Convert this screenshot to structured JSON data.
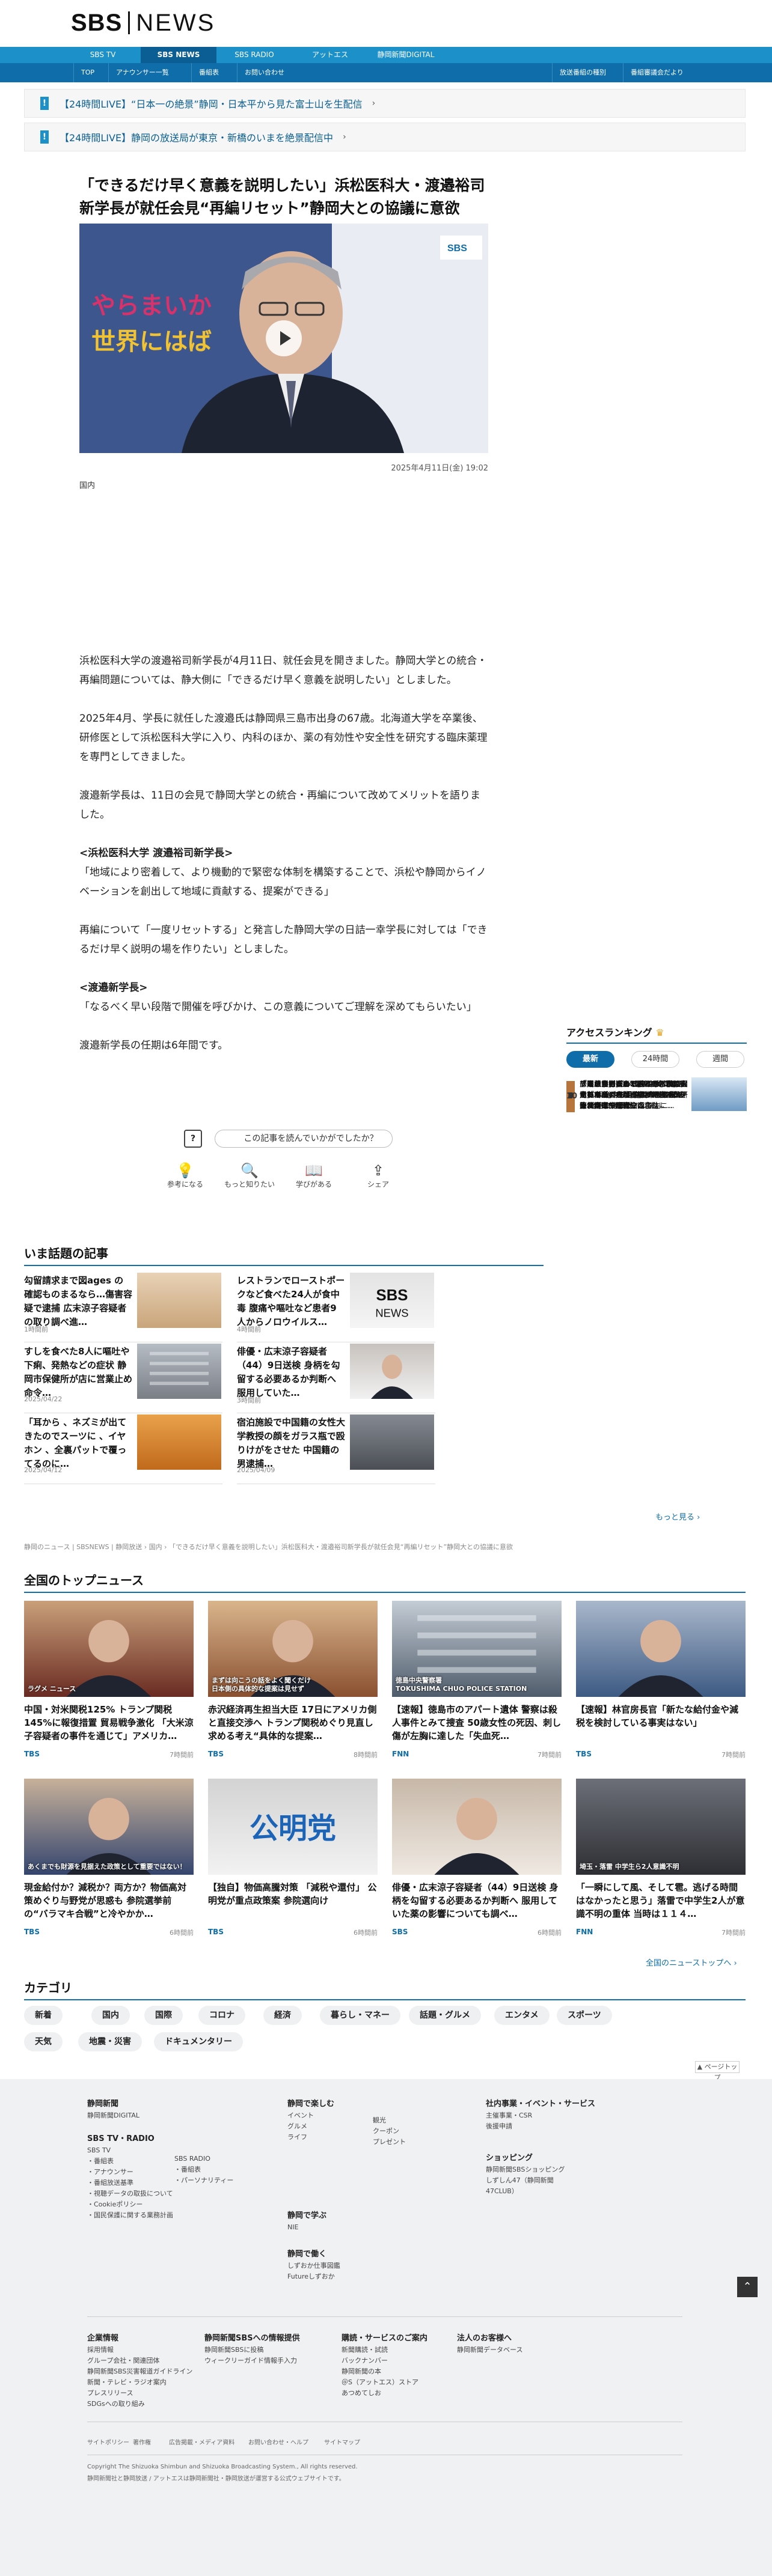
{
  "header": {
    "logo_sbs": "SBS",
    "logo_news": "NEWS"
  },
  "nav1": [
    {
      "label": "SBS TV",
      "active": false
    },
    {
      "label": "SBS NEWS",
      "active": true
    },
    {
      "label": "SBS RADIO",
      "active": false
    },
    {
      "label": "アットエス",
      "active": false
    },
    {
      "label": "静岡新聞DIGITAL",
      "active": false
    }
  ],
  "nav2": {
    "left": [
      "TOP",
      "アナウンサー一覧",
      "番組表",
      "お問い合わせ"
    ],
    "right": [
      "放送番組の種別",
      "番組審議会だより"
    ]
  },
  "alerts": [
    "【24時間LIVE】“日本一の絶景”静岡・日本平から見た富士山を生配信",
    "【24時間LIVE】静岡の放送局が東京・新橋のいまを絶景配信中"
  ],
  "article": {
    "title": "「できるだけ早く意義を説明したい」浜松医科大・渡邉裕司新学長が就任会見“再編リセット”静岡大との協議に意欲",
    "date": "2025年4月11日(金) 19:02",
    "category": "国内",
    "backdrop_text": "やらまいか\n世界にはば",
    "paragraphs": [
      {
        "h": false,
        "text": "浜松医科大学の渡邉裕司新学長が4月11日、就任会見を開きました。静岡大学との統合・再編問題については、静大側に「できるだけ早く意義を説明したい」としました。"
      },
      {
        "h": false,
        "text": "2025年4月、学長に就任した渡邉氏は静岡県三島市出身の67歳。北海道大学を卒業後、研修医として浜松医科大学に入り、内科のほか、薬の有効性や安全性を研究する臨床薬理を専門としてきました。"
      },
      {
        "h": false,
        "text": "渡邉新学長は、11日の会見で静岡大学との統合・再編について改めてメリットを語りました。"
      },
      {
        "h": true,
        "text": "<浜松医科大学 渡邉裕司新学長>"
      },
      {
        "h": false,
        "text": "「地域により密着して、より機動的で緊密な体制を構築することで、浜松や静岡からイノベーションを創出して地域に貢献する、提案ができる」"
      },
      {
        "h": false,
        "text": "再編について「一度リセットする」と発言した静岡大学の日詰一幸学長に対しては「できるだけ早く説明の場を作りたい」としました。"
      },
      {
        "h": true,
        "text": "<渡邉新学長>"
      },
      {
        "h": false,
        "text": "「なるべく早い段階で開催を呼びかけ、この意義についてご理解を深めてもらいたい」"
      },
      {
        "h": false,
        "text": "渡邉新学長の任期は6年間です。"
      }
    ]
  },
  "feedback": {
    "question": "この記事を読んでいかがでしたか？",
    "buttons": [
      {
        "label": "参考になる",
        "icon": "lightbulb-icon",
        "glyph": "💡"
      },
      {
        "label": "もっと知りたい",
        "icon": "search-icon",
        "glyph": "🔍"
      },
      {
        "label": "学びがある",
        "icon": "book-icon",
        "glyph": "📖"
      },
      {
        "label": "シェア",
        "icon": "share-icon",
        "glyph": "⇪"
      }
    ]
  },
  "topics": {
    "heading": "いま話題の記事",
    "items": [
      {
        "title": "勾留請求まで図ages の確認ものまるなら…傷害容疑で逮捕 広末涼子容疑者の取り調べ進…",
        "time": "1時間前",
        "img": "warm"
      },
      {
        "title": "レストランでローストポークなど食べた24人が食中毒 腹痛や嘔吐など患者9人からノロウイルス…",
        "time": "4時間前",
        "img": "sbslogo"
      },
      {
        "title": "すしを食べた8人に嘔吐や下痢、発熱などの症状 静岡市保健所が店に営業止め命令…",
        "time": "2025/04/22",
        "img": "building"
      },
      {
        "title": "俳優・広末涼子容疑者（44）9日送検 身柄を勾留する必要あるか判断へ 服用していた…",
        "time": "3時間前",
        "img": "woman"
      },
      {
        "title": "「耳から 、ネズミが出てきたのでスーツに 、イヤホン 、全裏パットで覆ってるのに…",
        "time": "2025/04/12",
        "img": "orange"
      },
      {
        "title": "宿泊施設で中国籍の女性大学教授の顔をガラス瓶で殴りけがをさせた 中国籍の男逮捕…",
        "time": "2025/04/09",
        "img": "gray"
      }
    ]
  },
  "ranking": {
    "heading": "アクセスランキング",
    "tabs": [
      {
        "label": "最新",
        "active": true
      },
      {
        "label": "24時間",
        "active": false
      },
      {
        "label": "週間",
        "active": false
      }
    ],
    "items": [
      {
        "n": "1",
        "color": "#e8a21b",
        "title": "すしを食べた8人に嘔吐や下痢、発熱などの症状 静岡市保健所が店に営業停止命令へ…",
        "img": "building"
      },
      {
        "n": "2",
        "color": "#9aa4ad",
        "title": "「あっち」あっち」ともん君さないで 観光地を撮影スコよて 被る 警備員の“ピッと”…",
        "img": "road"
      },
      {
        "n": "3",
        "color": "#b7743b",
        "title": "「常状態例」の20〜40代に増えている！ ウゴシタ“水面下のクチャ”ビーチ 判断も …一生に…",
        "img": "people"
      },
      {
        "n": "4",
        "color": "#555",
        "title": "「あのん」が、とうとう、家に火をつけるようだ」男が介護すべき母に向けて暴言…",
        "img": "fire"
      },
      {
        "n": "5",
        "color": "#555",
        "title": "「悪戯力も高められて呼ぶ相談みろ」ラグビーから学び新入社員研修 適格には最近…",
        "img": "sport"
      },
      {
        "n": "6",
        "color": "#555",
        "title": "「同じか嫌嫌して入ってるん」富士花島島の高地が高めて書く…ノースサファリサー…",
        "img": "aerial"
      },
      {
        "n": "7",
        "color": "#555",
        "title": "広末涼子容疑者 運搬直後になるで「自殺」たったのか その後、外れた理由は…交通事…",
        "img": "woman"
      },
      {
        "n": "8",
        "color": "#555",
        "title": "グループホームで80〜60代の男女10人食中毒 下痢や嘔吐などの症状訴え ノロウイルス…",
        "img": "building"
      },
      {
        "n": "9",
        "color": "#555",
        "title": "静岡県熊野大きく置れた子供の園児のため…弁当 小型入ろの建遊東サリニア開発に変化は…",
        "img": "field"
      },
      {
        "n": "10",
        "color": "#555",
        "title": "「週の日に 遊べる条件がうまいハッキリとしない」 外だまって、ハ寄が…自分の言動に…",
        "img": "sky"
      }
    ],
    "more": "もっと見る"
  },
  "breadcrumb": "静岡のニュース | SBSNEWS | 静岡放送 › 国内 › 「できるだけ早く意義を説明したい」浜松医科大・渡邉裕司新学長が就任会見“再編リセット”静岡大との協議に意欲",
  "topnews": {
    "heading": "全国のトップニュース",
    "items": [
      {
        "title": "中国・対米関税125% トランプ関税145%に報復措置 貿易戦争激化 「大米涼子容疑者の事件を通じて」アメリカ…",
        "src": "TBS",
        "time": "7時間前",
        "img": "xi",
        "caption": "ラグメ ニュース"
      },
      {
        "title": "赤沢経済再生担当大臣 17日にアメリカ側と直接交渉へ トランプ関税めぐり見直し求める考え“具体的な提案…",
        "src": "TBS",
        "time": "8時間前",
        "img": "akazawa",
        "caption": "まずは向こうの話をよく聞くだけ\n日本側の具体的な提案は見せず"
      },
      {
        "title": "【速報】徳島市のアパート遺体 警察は殺人事件とみて捜査 50歳女性の死因、刺し傷が左胸に達した「失血死…",
        "src": "FNN",
        "time": "7時間前",
        "img": "police",
        "caption": "徳島中央警察署\nTOKUSHIMA CHUO POLICE STATION"
      },
      {
        "title": "【速報】林官房長官「新たな給付金や減税を検討している事実はない」",
        "src": "TBS",
        "time": "7時間前",
        "img": "hayashi",
        "caption": ""
      },
      {
        "title": "現金給付か？減税か？両方か？物価高対策めぐり与野党が思惑も 参院選挙前の“バラマキ合戦”と冷やかか…",
        "src": "TBS",
        "time": "6時間前",
        "img": "kishida",
        "caption": "あくまでも財源を見据えた政策として重要ではない！"
      },
      {
        "title": "【独自】物価高騰対策 「減税や還付」 公明党が重点政策案 参院選向け",
        "src": "TBS",
        "time": "6時間前",
        "img": "komei",
        "caption": "公明党"
      },
      {
        "title": "俳優・広末涼子容疑者（44）9日送検 身柄を勾留する必要あるか判断へ 服用していた薬の影響についても調べ…",
        "src": "SBS",
        "time": "6時間前",
        "img": "woman2",
        "caption": ""
      },
      {
        "title": "「一瞬にして風、そして雹。逃げる時間はなかったと思う」落雷で中学生2人が意識不明の重体 当時は１１４…",
        "src": "FNN",
        "time": "7時間前",
        "img": "storm",
        "caption": "埼玉・落雷 中学生ら2人意識不明"
      }
    ],
    "more": "全国のニューストップへ"
  },
  "categories": {
    "heading": "カテゴリ",
    "items": [
      "新着",
      "国内",
      "国際",
      "コロナ",
      "経済",
      "暮らし・マネー",
      "話題・グルメ",
      "エンタメ",
      "スポーツ",
      "天気",
      "地震・災害",
      "ドキュメンタリー"
    ],
    "pagetop": "ページトップ"
  },
  "footer": {
    "cols": [
      {
        "head": "静岡新聞",
        "links": [
          "静岡新聞DIGITAL"
        ]
      },
      {
        "head": "SBS TV・RADIO",
        "links": [
          "SBS TV",
          "・番組表",
          "・アナウンサー",
          "・番組放送基準",
          "・視聴データの取扱について",
          "・Cookieポリシー",
          "・国民保護に関する業務計画"
        ]
      },
      {
        "head": "",
        "links": [
          "SBS RADIO",
          "・番組表",
          "・パーソナリティー"
        ]
      },
      {
        "head": "静岡で楽しむ",
        "links": [
          "イベント",
          "グルメ",
          "ライフ"
        ]
      },
      {
        "head": "",
        "links": [
          "観光",
          "クーポン",
          "プレゼント"
        ]
      },
      {
        "head": "静岡で学ぶ",
        "links": [
          "NIE"
        ]
      },
      {
        "head": "静岡で働く",
        "links": [
          "しずおか仕事図鑑",
          "Futureしずおか"
        ]
      },
      {
        "head": "社内事業・イベント・サービス",
        "links": [
          "主催事業・CSR",
          "後援申請"
        ]
      },
      {
        "head": "ショッピング",
        "links": [
          "静岡新聞SBSショッピング",
          "しずしん47（静岡新聞47CLUB）"
        ]
      }
    ],
    "cols2": [
      {
        "head": "企業情報",
        "links": [
          "採用情報",
          "グループ会社・関連団体",
          "静岡新聞SBS災害報道ガイドライン",
          "新聞・テレビ・ラジオ案内",
          "プレスリリース",
          "SDGsへの取り組み"
        ]
      },
      {
        "head": "静岡新聞SBSへの情報提供",
        "links": [
          "静岡新聞SBSに投稿",
          "ウィークリーガイド情報手入力"
        ]
      },
      {
        "head": "購読・サービスのご案内",
        "links": [
          "新聞購読・試読",
          "バックナンバー",
          "静岡新聞の本",
          "＠S（アットエス）ストア",
          "あつめてしお"
        ]
      },
      {
        "head": "法人のお客様へ",
        "links": [
          "静岡新聞データベース"
        ]
      }
    ],
    "bottom_links": [
      "サイトポリシー",
      "著作権",
      "広告掲載・メディア資料",
      "お問い合わせ・ヘルプ",
      "サイトマップ"
    ],
    "copyright": "Copyright The Shizuoka Shimbun and Shizuoka Broadcasting System., All rights reserved.",
    "note": "静岡新聞社と静岡放送 / アットエスは静岡新聞社・静岡放送が運営する公式ウェブサイトです。"
  },
  "colors": {
    "brand": "#0f6ea9",
    "nav": "#1c90c8"
  }
}
